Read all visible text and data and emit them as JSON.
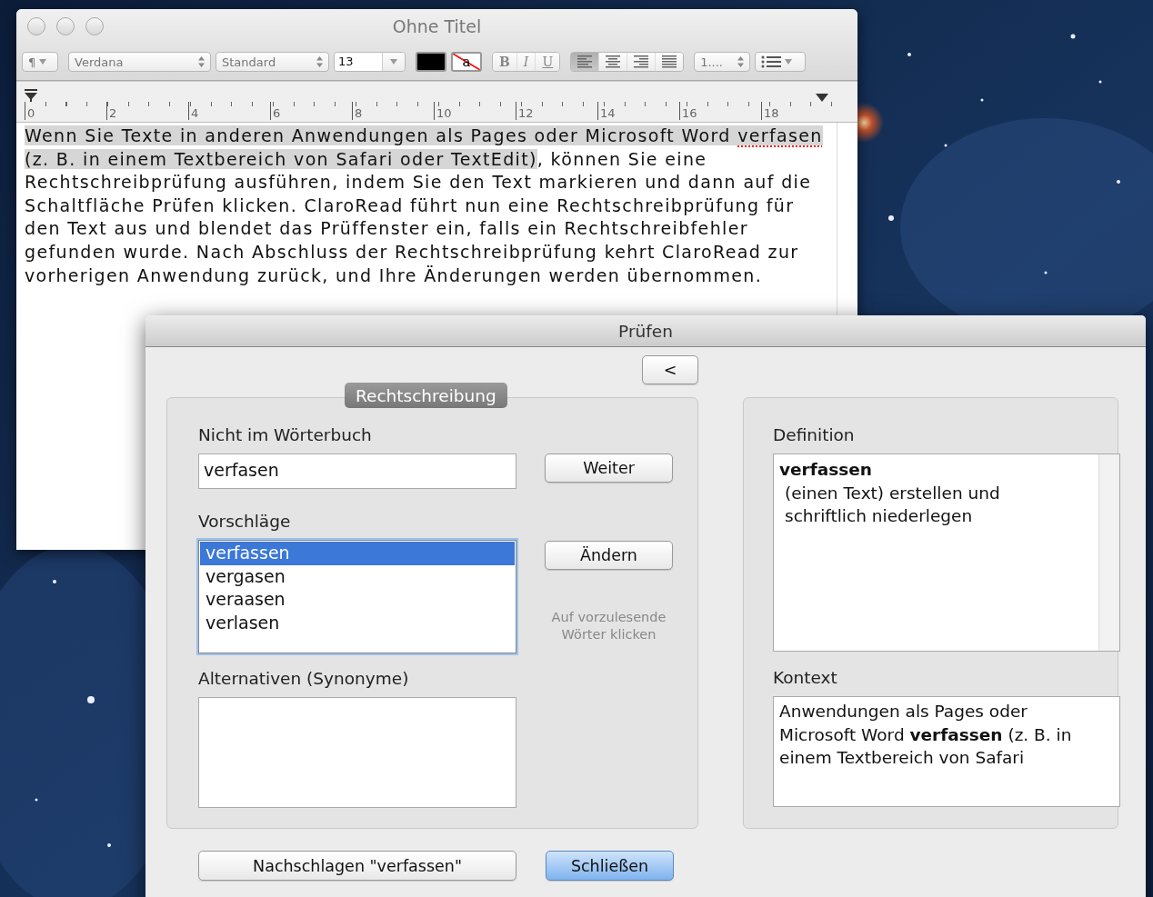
{
  "document_window": {
    "title": "Ohne Titel",
    "toolbar": {
      "paragraph_menu": "¶",
      "font": "Verdana",
      "typeface": "Standard",
      "size": "13",
      "highlight_swatch": "a",
      "format_buttons": [
        "B",
        "I",
        "U"
      ],
      "alignment": [
        {
          "kind": "left",
          "selected": true
        },
        {
          "kind": "center",
          "selected": false
        },
        {
          "kind": "right",
          "selected": false
        },
        {
          "kind": "justify",
          "selected": false
        }
      ],
      "spacing": "1...."
    },
    "ruler": [
      "0",
      "2",
      "4",
      "6",
      "8",
      "10",
      "12",
      "14",
      "16",
      "18"
    ],
    "text_parts": [
      {
        "text": "Wenn Sie Texte in anderen Anwendungen als Pages oder Microsoft Word ",
        "selected": true,
        "misspelled": false
      },
      {
        "text": "verfasen",
        "selected": true,
        "misspelled": true
      },
      {
        "text": " (z. B. in einem Textbereich von Safari oder TextEdit)",
        "selected": true,
        "misspelled": false
      },
      {
        "text": ", können Sie eine Rechtschreibprüfung ausführen, indem Sie den Text markieren und dann auf die Schaltfläche Prüfen klicken. ClaroRead führt nun eine Rechtschreibprüfung für den Text aus und blendet das Prüffenster ein, falls ein Rechtschreibfehler gefunden wurde. Nach Abschluss der Rechtschreibprüfung kehrt ClaroRead zur vorherigen Anwendung zurück, und Ihre Änderungen werden übernommen.",
        "selected": false,
        "misspelled": false
      }
    ]
  },
  "dialog": {
    "title": "Prüfen",
    "back_button": "<",
    "tab_label": "Rechtschreibung",
    "not_in_dictionary": {
      "label": "Nicht im Wörterbuch",
      "value": "verfasen"
    },
    "next_button": "Weiter",
    "suggestions": {
      "label": "Vorschläge",
      "items": [
        {
          "text": "verfassen",
          "selected": true
        },
        {
          "text": "vergasen",
          "selected": false
        },
        {
          "text": "veraasen",
          "selected": false
        },
        {
          "text": "verlasen",
          "selected": false
        }
      ]
    },
    "change_button": "Ändern",
    "hint": "Auf vorzulesende Wörter klicken",
    "alternatives": {
      "label": "Alternativen (Synonyme)"
    },
    "definition": {
      "label": "Definition",
      "term": "verfassen",
      "text": "(einen Text) erstellen und schriftlich niederlegen"
    },
    "context": {
      "label": "Kontext",
      "text": "Anwendungen als Pages oder Microsoft Word **verfassen** (z. B. in einem Textbereich von Safari"
    },
    "buttons": [
      {
        "label": "Nachschlagen \"verfassen\"",
        "default": false
      },
      {
        "label": "Schließen",
        "default": true
      }
    ]
  }
}
